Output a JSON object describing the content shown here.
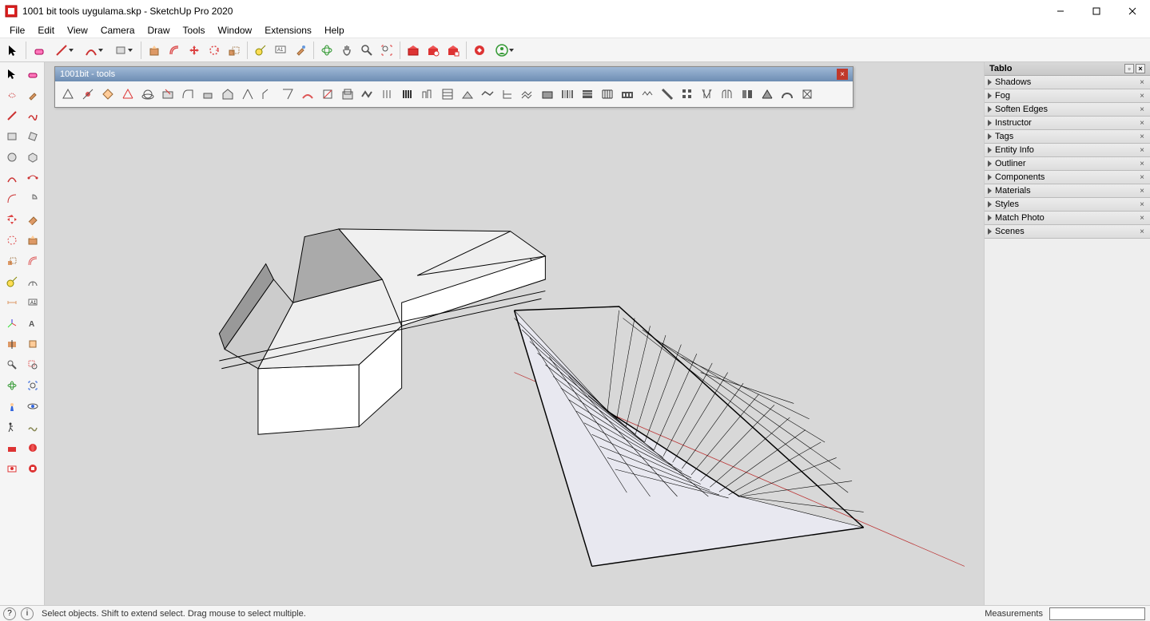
{
  "title": "1001 bit tools uygulama.skp - SketchUp Pro 2020",
  "menubar": [
    "File",
    "Edit",
    "View",
    "Camera",
    "Draw",
    "Tools",
    "Window",
    "Extensions",
    "Help"
  ],
  "floating_toolbar": {
    "title": "1001bit - tools"
  },
  "tray": {
    "header": "Tablo",
    "panels": [
      "Shadows",
      "Fog",
      "Soften Edges",
      "Instructor",
      "Tags",
      "Entity Info",
      "Outliner",
      "Components",
      "Materials",
      "Styles",
      "Match Photo",
      "Scenes"
    ]
  },
  "statusbar": {
    "hint": "Select objects. Shift to extend select. Drag mouse to select multiple.",
    "measurements_label": "Measurements"
  }
}
